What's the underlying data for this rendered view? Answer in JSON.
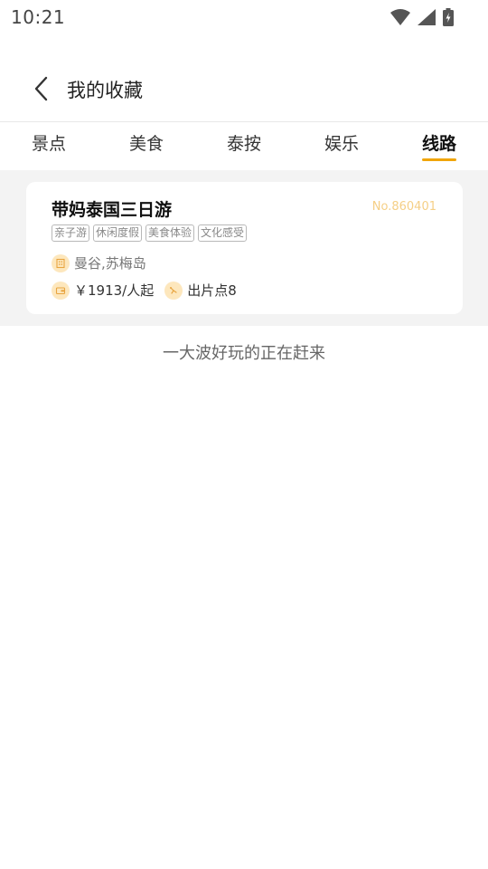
{
  "status_bar": {
    "time": "10:21"
  },
  "header": {
    "title": "我的收藏"
  },
  "tabs": [
    {
      "label": "景点",
      "active": false
    },
    {
      "label": "美食",
      "active": false
    },
    {
      "label": "泰按",
      "active": false
    },
    {
      "label": "娱乐",
      "active": false
    },
    {
      "label": "线路",
      "active": true
    }
  ],
  "card": {
    "title": "带妈泰国三日游",
    "number": "No.860401",
    "tags": [
      "亲子游",
      "休闲度假",
      "美食体验",
      "文化感受"
    ],
    "location": "曼谷,苏梅岛",
    "price": "￥1913/人起",
    "stops": "出片点8"
  },
  "footer_text": "一大波好玩的正在赶来",
  "colors": {
    "accent": "#f0a50a",
    "number_text": "#f5cf86",
    "icon_bg": "#fde7bd"
  }
}
